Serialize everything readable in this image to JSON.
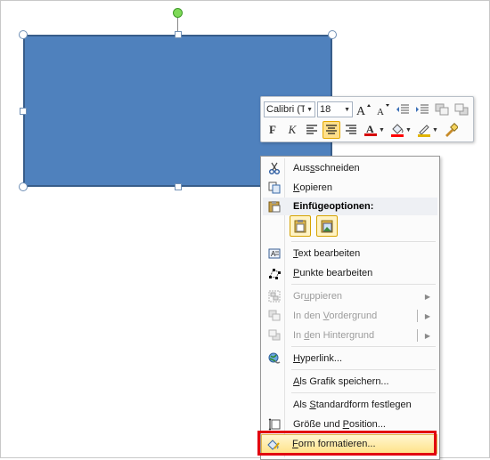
{
  "mini_toolbar": {
    "font_name": "Calibri (T",
    "font_size": "18",
    "bold_label": "F",
    "italic_label": "K",
    "font_color": "#d50000",
    "fill_color": "#ff0000",
    "line_color": "#e1b400"
  },
  "context_menu": {
    "cut": {
      "pre": "Aus",
      "key": "s",
      "post": "schneiden"
    },
    "copy": {
      "key": "K",
      "post": "opieren"
    },
    "paste_header": "Einfügeoptionen:",
    "edit_text": {
      "key": "T",
      "post": "ext bearbeiten"
    },
    "edit_points": {
      "key": "P",
      "post": "unkte bearbeiten"
    },
    "group": {
      "pre": "Gr",
      "key": "u",
      "post": "ppieren"
    },
    "bring_forward": {
      "pre": "In den ",
      "key": "V",
      "post": "ordergrund"
    },
    "send_backward": {
      "pre": "In ",
      "key": "d",
      "post": "en Hintergrund"
    },
    "hyperlink": {
      "key": "H",
      "post": "yperlink..."
    },
    "save_as_picture": {
      "key": "A",
      "post": "ls Grafik speichern..."
    },
    "set_default": {
      "pre": "Als ",
      "key": "S",
      "post": "tandardform festlegen"
    },
    "size_position": {
      "pre": "Größe und ",
      "key": "P",
      "post": "osition..."
    },
    "format_shape": {
      "key": "F",
      "post": "orm formatieren..."
    }
  },
  "colors": {
    "shape_fill": "#4f81bd",
    "shape_border": "#385d8a",
    "highlight_outline": "#e2000f"
  }
}
